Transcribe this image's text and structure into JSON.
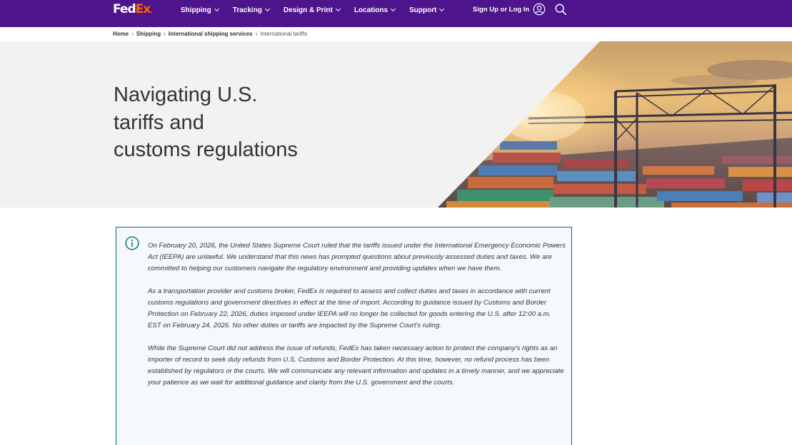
{
  "header": {
    "logo_fed": "Fed",
    "logo_ex": "Ex",
    "logo_tm": ".",
    "nav": [
      {
        "label": "Shipping"
      },
      {
        "label": "Tracking"
      },
      {
        "label": "Design & Print"
      },
      {
        "label": "Locations"
      },
      {
        "label": "Support"
      }
    ],
    "signin_label": "Sign Up or Log In",
    "icons": {
      "user": "user-circle-icon",
      "search": "search-icon"
    },
    "colors": {
      "background": "#4d148c",
      "fed": "#ffffff",
      "ex": "#ff6200"
    }
  },
  "breadcrumb": {
    "items": [
      "Home",
      "Shipping",
      "International shipping services"
    ],
    "current": "International tariffs"
  },
  "hero": {
    "title_line1": "Navigating U.S.",
    "title_line2": "tariffs and",
    "title_line3": "customs regulations",
    "image": "shipping-container-port-at-sunset"
  },
  "alert": {
    "icon": "info-icon",
    "accent_color": "#0a6a77",
    "paragraphs": [
      "On February 20, 2026, the United States Supreme Court ruled that the tariffs issued under the International Emergency Economic Powers Act (IEEPA) are unlawful. We understand that this news has prompted questions about previously assessed duties and taxes. We are committed to helping our customers navigate the regulatory environment and providing updates when we have them.",
      "As a transportation provider and customs broker, FedEx is required to assess and collect duties and taxes in accordance with current customs regulations and government directives in effect at the time of import.  According to guidance issued by Customs and Border Protection on February 22, 2026, duties imposed under IEEPA will no longer be collected for goods entering the U.S. after 12:00 a.m. EST on February 24, 2026.  No other duties or tariffs are impacted by the Supreme Court's ruling.",
      "While the Supreme Court did not address the issue of refunds, FedEx has taken necessary action to protect the company's rights as an importer of record to seek duty refunds from U.S. Customs and Border Protection. At this time, however, no refund process has been established by regulators or the courts. We will communicate any relevant information and updates in a timely manner, and we appreciate your patience as we wait for additional guidance and clarity from the U.S. government and the courts."
    ]
  }
}
